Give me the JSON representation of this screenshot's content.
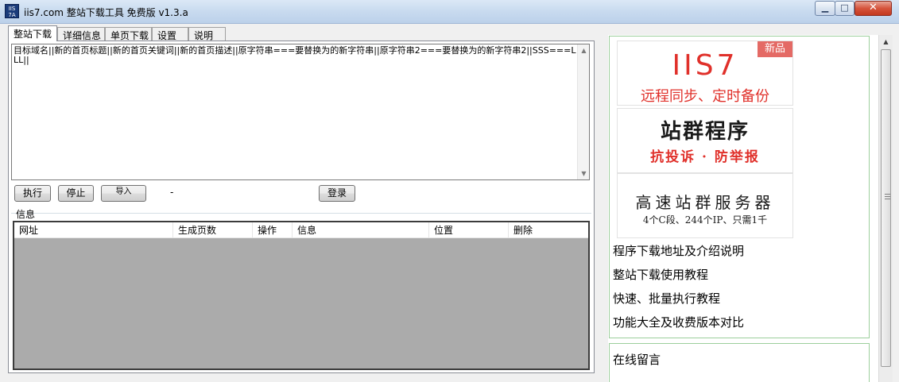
{
  "window": {
    "title": "iis7.com 整站下载工具 免费版  v1.3.a",
    "icon_text": "IIS 7A",
    "controls": {
      "minimize": "minimize-icon",
      "maximize": "maximize-icon",
      "close": "close-icon"
    }
  },
  "tabs": [
    {
      "label": "整站下载",
      "active": true
    },
    {
      "label": "详细信息",
      "active": false
    },
    {
      "label": "单页下载",
      "active": false
    },
    {
      "label": "设置",
      "active": false
    },
    {
      "label": "说明",
      "active": false
    }
  ],
  "command_box": {
    "value": "目标域名||新的首页标题||新的首页关键词||新的首页描述||原字符串===要替换为的新字符串||原字符串2===要替换为的新字符串2||SSS===LLL||"
  },
  "buttons": {
    "execute": "执行",
    "stop": "停止",
    "import": "导入",
    "status_dash": "-",
    "login": "登录"
  },
  "info": {
    "group_label": "信息",
    "columns": [
      "网址",
      "生成页数",
      "操作",
      "信息",
      "位置",
      "删除"
    ],
    "rows": []
  },
  "promo": {
    "banner1": {
      "logo": "IIS7",
      "badge": "新品",
      "slogan": "远程同步、定时备份"
    },
    "banner2": {
      "title": "站群程序",
      "subtitle": "抗投诉 · 防举报"
    },
    "banner3": {
      "title": "高速站群服务器",
      "subtitle": "4个C段、244个IP、只需1千"
    },
    "links": [
      "程序下载地址及介绍说明",
      "整站下载使用教程",
      "快速、批量执行教程",
      "功能大全及收费版本对比"
    ],
    "message": "在线留言"
  },
  "colors": {
    "accent_red": "#e0302a",
    "promo_border": "#9ccf9c",
    "list_bg": "#ababab"
  }
}
